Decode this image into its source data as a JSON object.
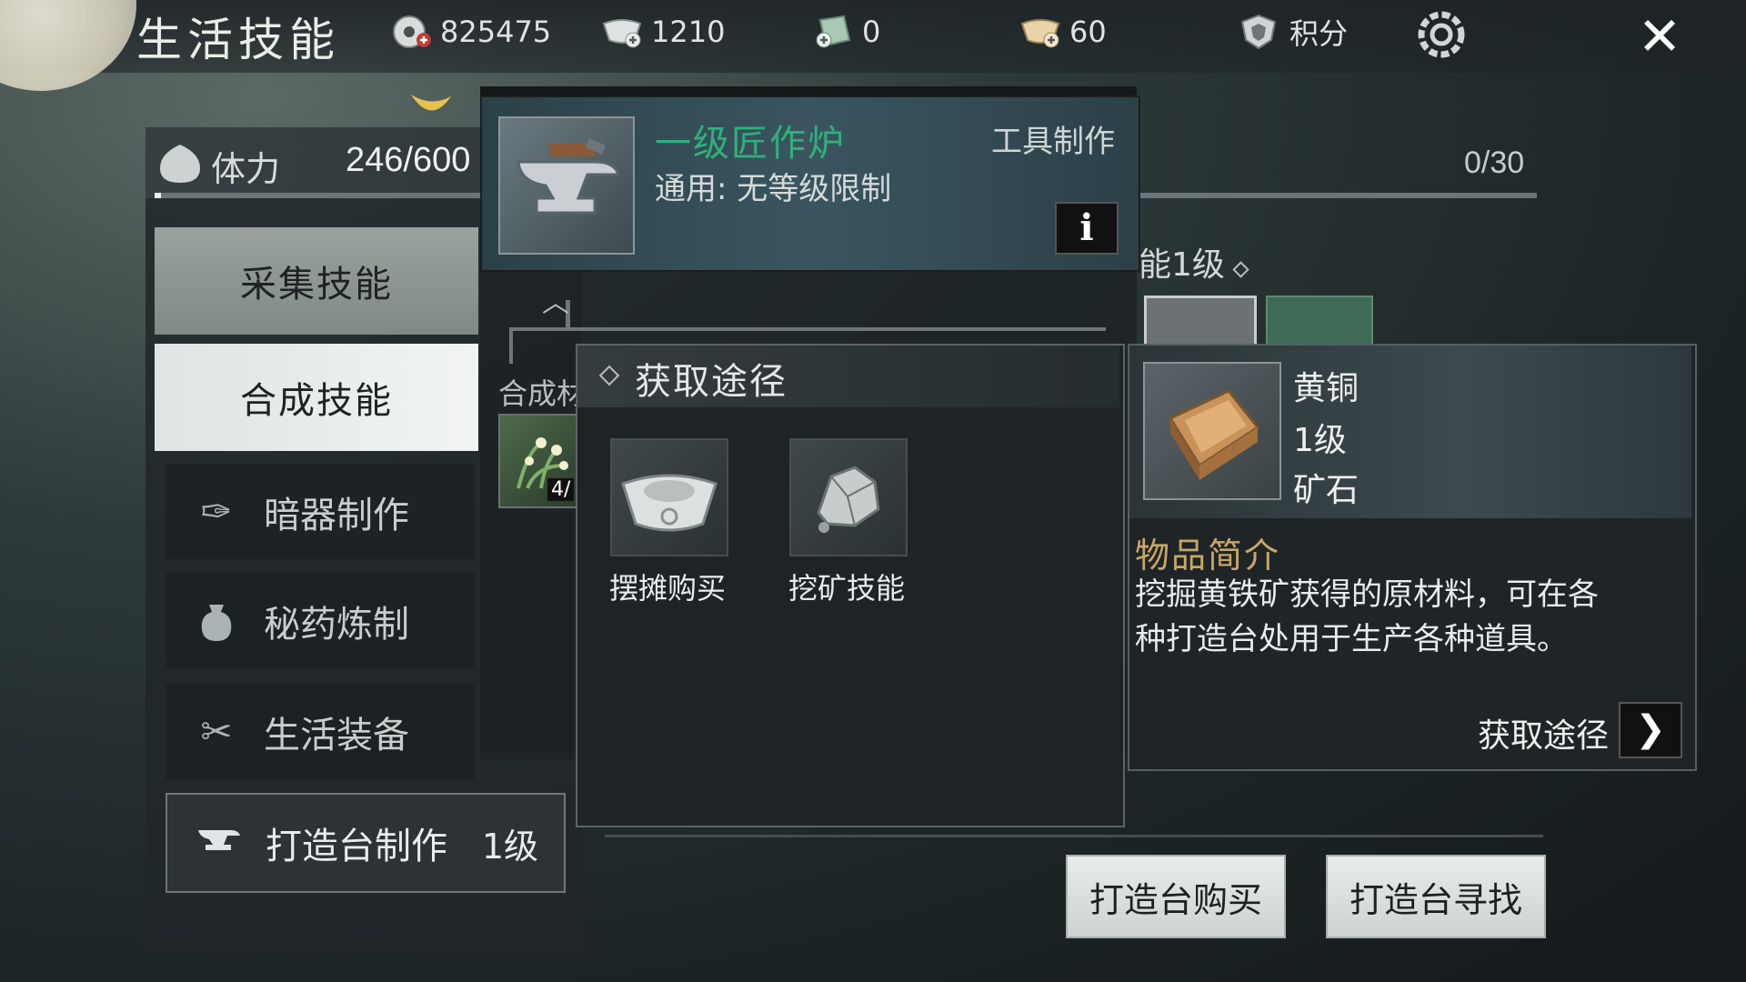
{
  "header": {
    "title": "生活技能",
    "resources": [
      {
        "icon": "coin-icon",
        "value": "825475"
      },
      {
        "icon": "silver-ingot-icon",
        "value": "1210"
      },
      {
        "icon": "jade-ticket-icon",
        "value": "0"
      },
      {
        "icon": "gold-ingot-icon",
        "value": "60"
      }
    ],
    "points_label": "积分",
    "close_icon": "close-icon"
  },
  "stamina": {
    "label": "体力",
    "value": "246/600",
    "fraction": 0.41,
    "right_count": "0/30"
  },
  "left_menu": {
    "gather": "采集技能",
    "craft": "合成技能",
    "sub_items": [
      {
        "label": "暗器制作",
        "icon": "dart-icon"
      },
      {
        "label": "秘药炼制",
        "icon": "medicine-pouch-icon"
      },
      {
        "label": "生活装备",
        "icon": "scissors-icon"
      },
      {
        "label": "打造台制作",
        "icon": "anvil-icon",
        "level": "1级",
        "active": true
      }
    ]
  },
  "item_header": {
    "name": "一级匠作炉",
    "category": "工具制作",
    "requirement": "通用: 无等级限制",
    "info_label": "i",
    "materials_label": "合成材",
    "material_count": "4/"
  },
  "skill_level_title": "能1级",
  "source_popup": {
    "title": "获取途径",
    "items": [
      {
        "label": "摆摊购买",
        "icon": "silver-ingot-icon"
      },
      {
        "label": "挖矿技能",
        "icon": "ore-rock-icon"
      }
    ]
  },
  "item_detail": {
    "name": "黄铜",
    "level": "1级",
    "type": "矿石",
    "section_title": "物品简介",
    "description": "挖掘黄铁矿获得的原材料，可在各种打造台处用于生产各种道具。",
    "source_link": "获取途径"
  },
  "buttons": {
    "buy": "打造台购买",
    "find": "打造台寻找"
  }
}
